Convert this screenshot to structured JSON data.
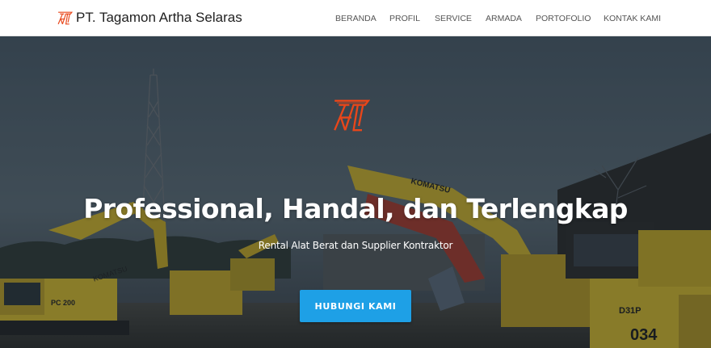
{
  "header": {
    "brand": {
      "logo_icon": "at-monogram-icon",
      "name": "PT. Tagamon Artha Selaras"
    },
    "nav": [
      {
        "label": "BERANDA"
      },
      {
        "label": "PROFIL"
      },
      {
        "label": "SERVICE"
      },
      {
        "label": "ARMADA"
      },
      {
        "label": "PORTOFOLIO"
      },
      {
        "label": "KONTAK KAMI"
      }
    ]
  },
  "hero": {
    "logo_icon": "at-monogram-icon",
    "title": "Professional, Handal, dan Terlengkap",
    "subtitle": "Rental Alat Berat dan Supplier Kontraktor",
    "cta_label": "HUBUNGI KAMI",
    "background_image": "excavator-yard-photo",
    "machine_labels": [
      "KOMATSU",
      "PC 200",
      "KOMATSU",
      "D31P",
      "034"
    ]
  },
  "colors": {
    "brand_orange": "#e8461a",
    "button_blue": "#1ea0e6",
    "header_bg": "#ffffff",
    "nav_text": "#555555",
    "hero_text": "#ffffff"
  }
}
